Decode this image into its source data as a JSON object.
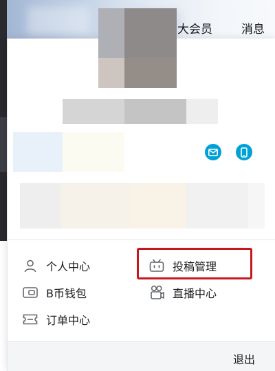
{
  "header": {
    "vip_label": "大会员",
    "messages_label": "消息"
  },
  "profile": {
    "icons": [
      "mail-icon",
      "phone-icon"
    ],
    "accent_color": "#00a1d6"
  },
  "menu": {
    "left": [
      {
        "label": "个人中心",
        "icon": "person-icon"
      },
      {
        "label": "B币钱包",
        "icon": "wallet-icon"
      },
      {
        "label": "订单中心",
        "icon": "ticket-icon"
      }
    ],
    "right": [
      {
        "label": "投稿管理",
        "icon": "tv-icon"
      },
      {
        "label": "直播中心",
        "icon": "live-camera-icon"
      }
    ]
  },
  "highlight_color": "#c8161d",
  "footer": {
    "logout_label": "退出"
  }
}
